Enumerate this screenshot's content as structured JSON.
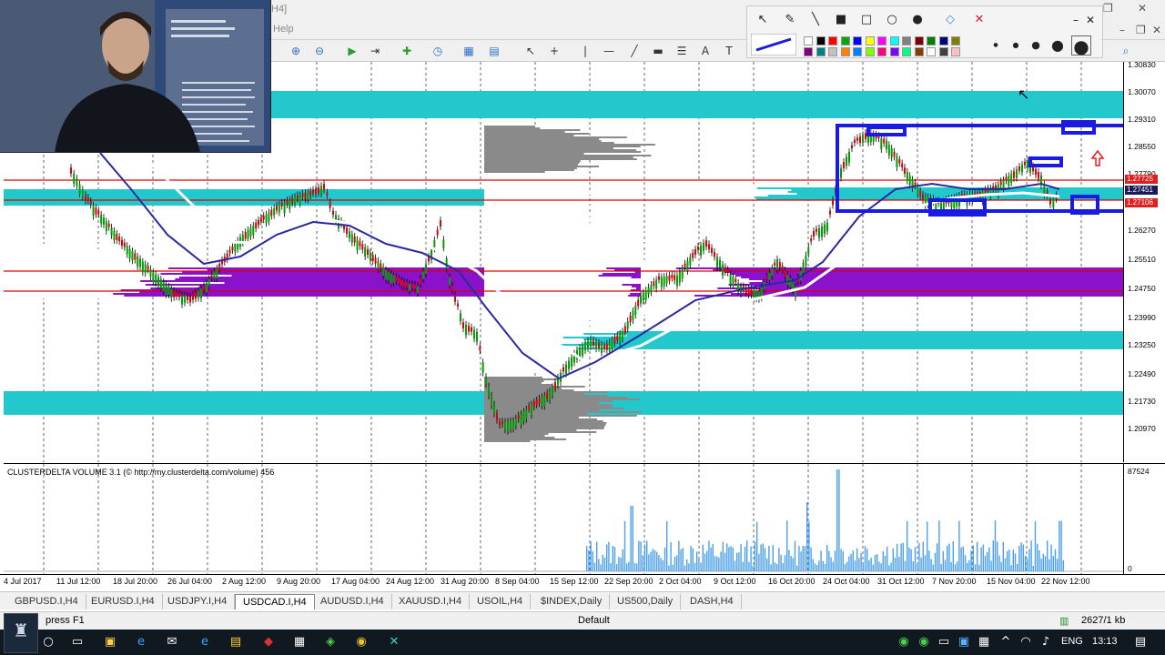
{
  "window": {
    "title_fragment": "H4]",
    "menu_help": "Help",
    "controls": {
      "minimize": "–",
      "restore": "❐",
      "close": "✕"
    }
  },
  "toolbar": {
    "icons": [
      "zoom-in-icon",
      "zoom-out-icon",
      "chart-shift-icon",
      "autoscroll-icon",
      "indicators-icon",
      "periods-icon",
      "templates-icon",
      "cursor-icon",
      "crosshair-icon",
      "vertical-line-icon",
      "horizontal-line-icon",
      "trendline-icon",
      "channel-icon",
      "fibonacci-icon",
      "text-icon",
      "text-label-icon"
    ],
    "search_icon": "🔍"
  },
  "draw_panel": {
    "tools": [
      "arrow-select-icon",
      "pen-icon",
      "line-icon",
      "filled-rect-icon",
      "rect-icon",
      "ellipse-icon",
      "filled-ellipse-icon",
      "eraser-icon",
      "clear-icon"
    ],
    "colors": [
      "#ffffff",
      "#000000",
      "#ff0000",
      "#00aa00",
      "#0000ff",
      "#ffff00",
      "#ff00ff",
      "#00ffff",
      "#808080",
      "#800000",
      "#008000",
      "#000080",
      "#808000",
      "#800080",
      "#008080",
      "#c0c0c0",
      "#ff8000",
      "#0080ff",
      "#80ff00",
      "#ff0080",
      "#8000ff",
      "#00ff80",
      "#804000",
      "#ffffff",
      "#404040",
      "#ffc0c0"
    ],
    "sizes": [
      "1",
      "2",
      "3",
      "4",
      "5"
    ],
    "panel_controls": {
      "minimize": "–",
      "close": "✕"
    }
  },
  "price_axis": {
    "labels": [
      "1.30830",
      "1.30070",
      "1.29310",
      "1.28550",
      "1.27790",
      "1.27030",
      "1.26270",
      "1.25510",
      "1.24750",
      "1.23990",
      "1.23250",
      "1.22490",
      "1.21730",
      "1.20970"
    ],
    "tags": [
      {
        "text": "1.27725",
        "kind": "red"
      },
      {
        "text": "1.27451",
        "kind": "dark"
      },
      {
        "text": "1.27106",
        "kind": "red"
      }
    ]
  },
  "indicator": {
    "title": "CLUSTERDELTA VOLUME 3.1 (© http://my.clusterdelta.com/volume) 456",
    "axis_top": "87524",
    "axis_bottom": "0"
  },
  "time_axis": {
    "labels": [
      "4 Jul 2017",
      "11 Jul 12:00",
      "18 Jul 20:00",
      "26 Jul 04:00",
      "2 Aug 12:00",
      "9 Aug 20:00",
      "17 Aug 04:00",
      "24 Aug 12:00",
      "31 Aug 20:00",
      "8 Sep 04:00",
      "15 Sep 12:00",
      "22 Sep 20:00",
      "2 Oct 04:00",
      "9 Oct 12:00",
      "16 Oct 20:00",
      "24 Oct 04:00",
      "31 Oct 12:00",
      "7 Nov 20:00",
      "15 Nov 04:00",
      "22 Nov 12:00"
    ]
  },
  "tabs": [
    {
      "label": "GBPUSD.I,H4",
      "active": false
    },
    {
      "label": "EURUSD.I,H4",
      "active": false
    },
    {
      "label": "USDJPY.I,H4",
      "active": false
    },
    {
      "label": "USDCAD.I,H4",
      "active": true
    },
    {
      "label": "AUDUSD.I,H4",
      "active": false
    },
    {
      "label": "XAUUSD.I,H4",
      "active": false
    },
    {
      "label": "USOIL,H4",
      "active": false
    },
    {
      "label": "$INDEX,Daily",
      "active": false
    },
    {
      "label": "US500,Daily",
      "active": false
    },
    {
      "label": "DASH,H4",
      "active": false
    }
  ],
  "status": {
    "hint": "press F1",
    "profile": "Default",
    "traffic": "2627/1 kb"
  },
  "taskbar": {
    "language": "ENG",
    "time": "13:13"
  },
  "colors": {
    "cyan_zone": "#23c8cc",
    "purple_zone": "#8a12c8",
    "ma_blue": "#2a2aa0",
    "ma_white": "#ffffff",
    "bear_candle": "#e00000",
    "bull_candle": "#00a000",
    "annotation_blue": "#1a1ae0",
    "volume_bar": "#4a9ff0"
  }
}
